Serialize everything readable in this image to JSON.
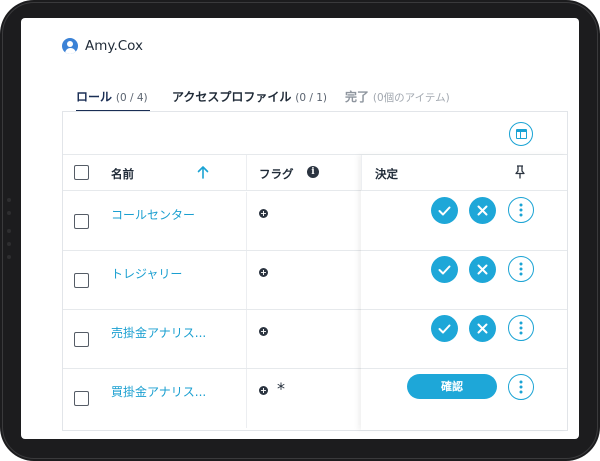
{
  "user": {
    "name": "Amy.Cox"
  },
  "tabs": [
    {
      "label": "ロール",
      "count": "(0 / 4)"
    },
    {
      "label": "アクセスプロファイル",
      "count": "(0 / 1)"
    },
    {
      "label": "完了",
      "count": "(0個のアイテム)"
    }
  ],
  "table": {
    "columns": {
      "name": "名前",
      "flags": "フラグ",
      "decision": "決定"
    },
    "rows": [
      {
        "name": "コールセンター",
        "flag_plus": "+",
        "flag_star": ""
      },
      {
        "name": "トレジャリー",
        "flag_plus": "+",
        "flag_star": ""
      },
      {
        "name": "売掛金アナリス...",
        "flag_plus": "+",
        "flag_star": ""
      },
      {
        "name": "買掛金アナリス...",
        "flag_plus": "+",
        "flag_star": "*",
        "confirm_label": "確認"
      }
    ]
  },
  "colors": {
    "accent": "#1ea7d8",
    "active_tab": "#1a2e55",
    "link": "#1a9fd0"
  }
}
